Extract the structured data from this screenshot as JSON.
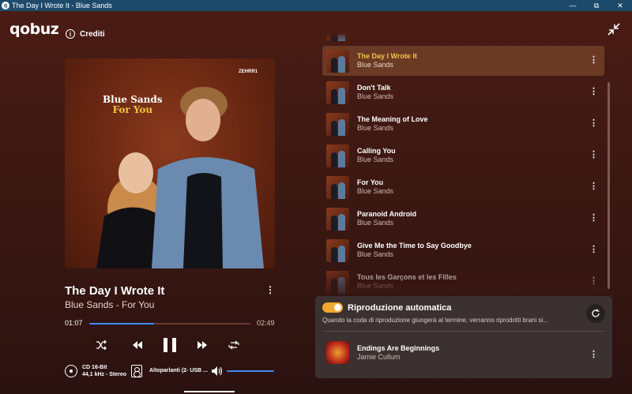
{
  "window": {
    "title": "The Day I Wrote It - Blue Sands",
    "minimize": "—",
    "maximize": "⧉",
    "close": "✕"
  },
  "app": {
    "logo": "qobuz",
    "credits_label": "Crediti"
  },
  "cover": {
    "artist": "Blue Sands",
    "album": "For You",
    "label": "ZEHRR1"
  },
  "now_playing": {
    "title": "The Day I Wrote It",
    "subtitle": "Blue Sands - For You",
    "current_time": "01:07",
    "total_time": "02:49",
    "progress": 0.4
  },
  "quality": {
    "format": "CD 16-Bit",
    "details": "44,1 kHz - Stereo"
  },
  "output": {
    "label": "Altoparlanti (2- USB ..."
  },
  "volume": {
    "level": 1.0
  },
  "queue": [
    {
      "title": "The Day I Wrote It",
      "artist": "Blue Sands",
      "current": true
    },
    {
      "title": "Don't Talk",
      "artist": "Blue Sands"
    },
    {
      "title": "The Meaning of Love",
      "artist": "Blue Sands"
    },
    {
      "title": "Calling You",
      "artist": "Blue Sands"
    },
    {
      "title": "For You",
      "artist": "Blue Sands"
    },
    {
      "title": "Paranoid Android",
      "artist": "Blue Sands"
    },
    {
      "title": "Give Me the Time to Say Goodbye",
      "artist": "Blue Sands"
    },
    {
      "title": "Tous les Garçons et les Filles",
      "artist": "Blue Sands"
    }
  ],
  "autoplay": {
    "title": "Riproduzione automatica",
    "description": "Quando la coda di riproduzione giungerà al termine, verranno riprodotti brani si...",
    "enabled": true,
    "track": {
      "title": "Endings Are Beginnings",
      "artist": "Jamie Cullum"
    }
  },
  "colors": {
    "accent": "#3f8cf0",
    "current_track": "#f4c04e",
    "toggle": "#f0a830",
    "titlebar": "#1d4a6b"
  }
}
